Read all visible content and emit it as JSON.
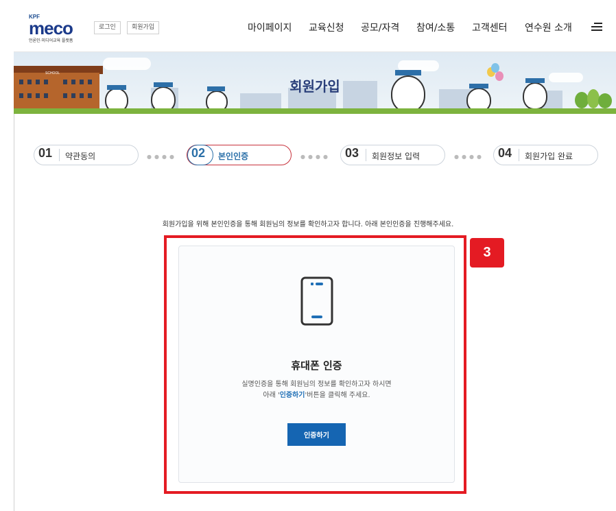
{
  "header": {
    "logo": {
      "kpf": "KPF",
      "word": "meco",
      "sub": "언론인·미디어교육 플랫폼"
    },
    "login_label": "로그인",
    "join_label": "회원가입",
    "nav": [
      "마이페이지",
      "교육신청",
      "공모/자격",
      "참여/소통",
      "고객센터",
      "연수원 소개"
    ]
  },
  "banner": {
    "title": "회원가입",
    "school_sign": "SCHOOL"
  },
  "steps": [
    {
      "num": "01",
      "label": "약관동의"
    },
    {
      "num": "02",
      "label": "본인인증"
    },
    {
      "num": "03",
      "label": "회원정보 입력"
    },
    {
      "num": "04",
      "label": "회원가입 완료"
    }
  ],
  "active_step": 2,
  "content": {
    "intro": "회원가입을 위해 본인인증을 통해 회원님의 정보를 확인하고자 합니다. 아래 본인인증을 진행해주세요.",
    "card_title": "휴대폰 인증",
    "desc_line1": "실명인증을 통해 회원님의 정보를 확인하고자 하시면",
    "desc_line2_prefix": "아래 '",
    "desc_line2_highlight": "인증하기",
    "desc_line2_suffix": "'버튼을 클릭해 주세요.",
    "button_label": "인증하기"
  },
  "annotation": {
    "badge": "3",
    "color": "#e41b23"
  },
  "icons": {
    "phone": "mobile-phone-icon",
    "menu": "hamburger-menu-icon"
  },
  "colors": {
    "brand": "#1565b2",
    "active_border": "#c7313b",
    "highlight": "#e41b23"
  }
}
